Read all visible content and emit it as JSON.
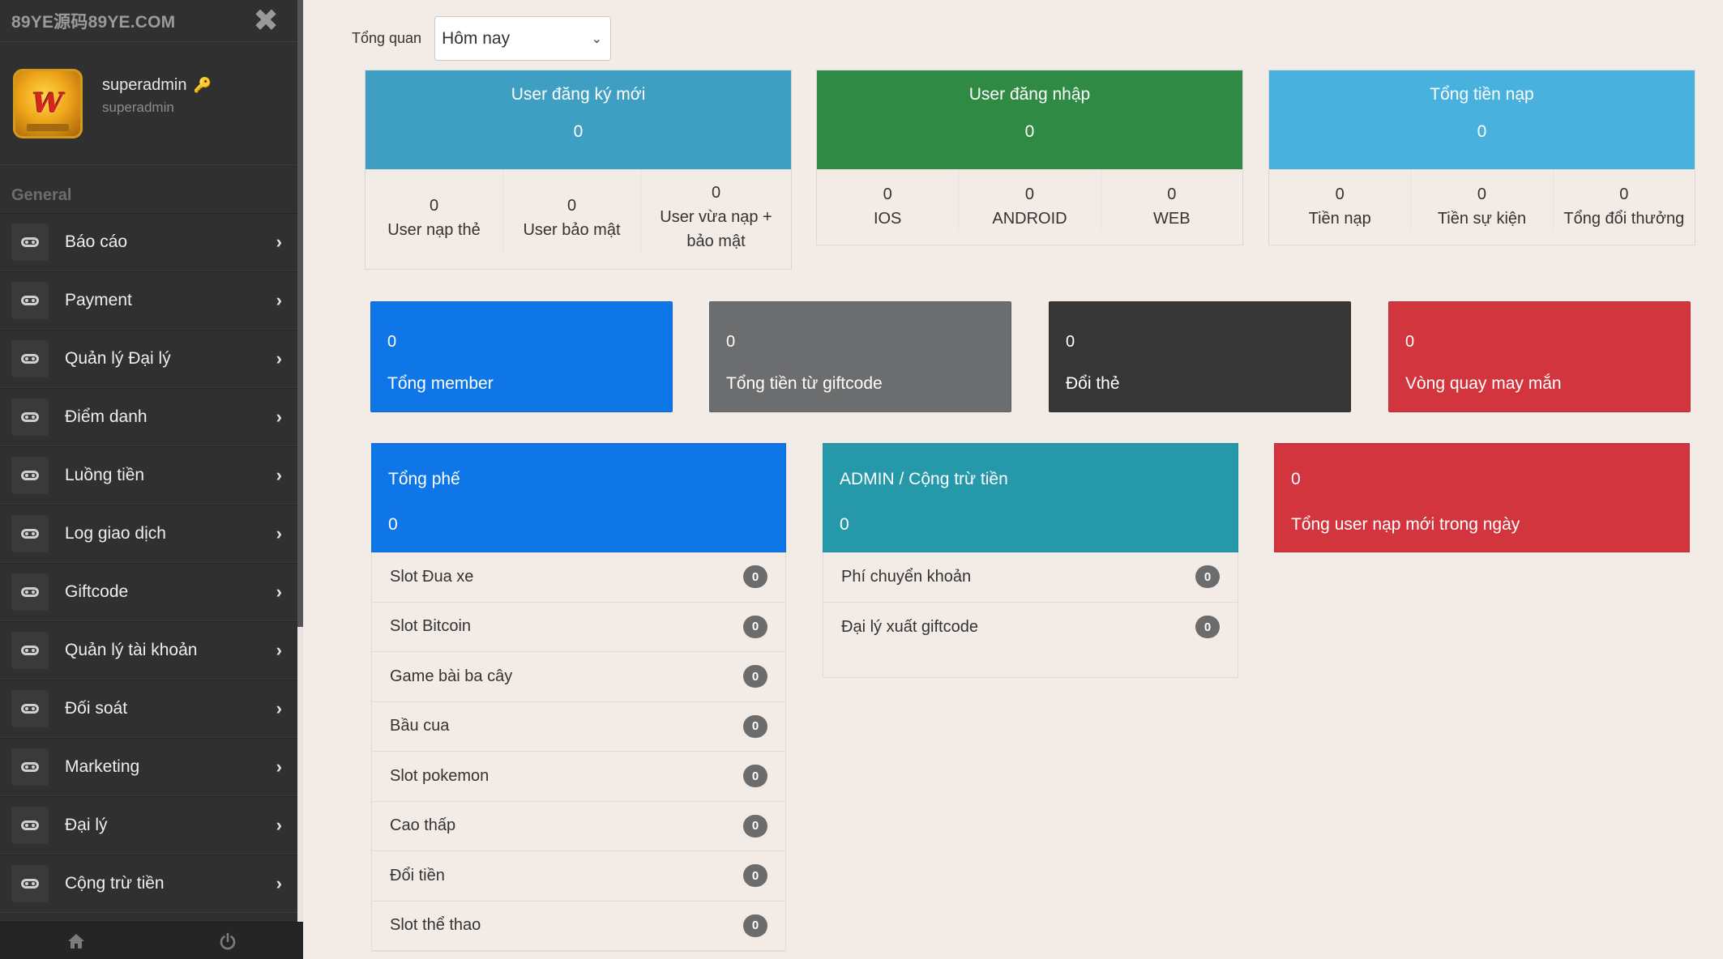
{
  "sidebar": {
    "brand": "89YE源码89YE.COM",
    "profile": {
      "name": "superadmin",
      "role": "superadmin"
    },
    "section": "General",
    "items": [
      {
        "label": "Báo cáo"
      },
      {
        "label": "Payment"
      },
      {
        "label": "Quản lý Đại lý"
      },
      {
        "label": "Điểm danh"
      },
      {
        "label": "Luồng tiền"
      },
      {
        "label": "Log giao dịch"
      },
      {
        "label": "Giftcode"
      },
      {
        "label": "Quản lý tài khoản"
      },
      {
        "label": "Đối soát"
      },
      {
        "label": "Marketing"
      },
      {
        "label": "Đại lý"
      },
      {
        "label": "Cộng trừ tiền"
      }
    ]
  },
  "filter": {
    "label": "Tổng quan",
    "selected": "Hôm nay"
  },
  "stats": [
    {
      "title": "User đăng ký mới",
      "value": "0",
      "color": "#3e9fc3",
      "cols": [
        {
          "v": "0",
          "l": "User nạp thẻ"
        },
        {
          "v": "0",
          "l": "User bảo mật"
        },
        {
          "v": "0",
          "l": "User vừa nạp + bảo mật"
        }
      ]
    },
    {
      "title": "User đăng nhập",
      "value": "0",
      "color": "#2f8b44",
      "cols": [
        {
          "v": "0",
          "l": "IOS"
        },
        {
          "v": "0",
          "l": "ANDROID"
        },
        {
          "v": "0",
          "l": "WEB"
        }
      ]
    },
    {
      "title": "Tổng tiền nạp",
      "value": "0",
      "color": "#49b1de",
      "cols": [
        {
          "v": "0",
          "l": "Tiền nạp"
        },
        {
          "v": "0",
          "l": "Tiền sự kiện"
        },
        {
          "v": "0",
          "l": "Tổng đổi thưởng"
        }
      ]
    }
  ],
  "tiles": [
    {
      "value": "0",
      "label": "Tổng member",
      "color": "#0e76e6"
    },
    {
      "value": "0",
      "label": "Tổng tiền từ giftcode",
      "color": "#6c6d6f"
    },
    {
      "value": "0",
      "label": "Đổi thẻ",
      "color": "#363637"
    },
    {
      "value": "0",
      "label": "Vòng quay may mắn",
      "color": "#d2353d"
    }
  ],
  "panels": {
    "fee": {
      "title": "Tổng phế",
      "value": "0",
      "color": "#0e76e6",
      "rows": [
        {
          "label": "Slot Đua xe",
          "count": "0"
        },
        {
          "label": "Slot Bitcoin",
          "count": "0"
        },
        {
          "label": "Game bài ba cây",
          "count": "0"
        },
        {
          "label": "Bầu cua",
          "count": "0"
        },
        {
          "label": "Slot pokemon",
          "count": "0"
        },
        {
          "label": "Cao thấp",
          "count": "0"
        },
        {
          "label": "Đổi tiền",
          "count": "0"
        },
        {
          "label": "Slot thể thao",
          "count": "0"
        }
      ]
    },
    "admin": {
      "title": "ADMIN / Cộng trừ tiền",
      "value": "0",
      "color": "#2599aa",
      "rows": [
        {
          "label": "Phí chuyển khoản",
          "count": "0"
        },
        {
          "label": "Đại lý xuất giftcode",
          "count": "0"
        }
      ]
    },
    "newusers": {
      "value": "0",
      "label": "Tổng user nạp mới trong ngày",
      "color": "#d2353d"
    }
  }
}
